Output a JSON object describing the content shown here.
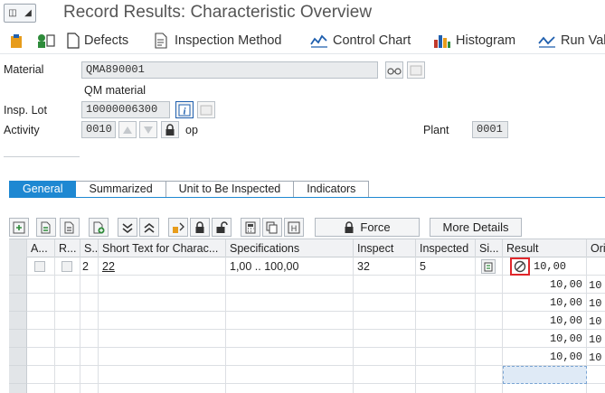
{
  "window": {
    "title": "Record Results: Characteristic Overview"
  },
  "toolbar": {
    "defects": "Defects",
    "inspection_method": "Inspection Method",
    "control_chart": "Control Chart",
    "histogram": "Histogram",
    "run_chart": "Run Val"
  },
  "form": {
    "material_label": "Material",
    "material_value": "QMA890001",
    "material_desc": "QM material",
    "insp_lot_label": "Insp. Lot",
    "insp_lot_value": "10000006300",
    "activity_label": "Activity",
    "activity_value": "0010",
    "activity_desc": "op",
    "plant_label": "Plant",
    "plant_value": "0001"
  },
  "tabs": [
    {
      "label": "General",
      "active": true
    },
    {
      "label": "Summarized"
    },
    {
      "label": "Unit to Be Inspected"
    },
    {
      "label": "Indicators"
    }
  ],
  "grid_toolbar": {
    "force": "Force",
    "more_details": "More Details"
  },
  "grid": {
    "columns": [
      "A...",
      "R...",
      "S...",
      "Short Text for Charac...",
      "Specifications",
      "Inspect",
      "Inspected",
      "Si...",
      "Result",
      "Ori"
    ],
    "main_row": {
      "seq": "2",
      "short_text": "22",
      "specifications": "1,00 .. 100,00",
      "inspect": "32",
      "inspected": "5",
      "result": "10,00"
    },
    "sub_rows": [
      {
        "result": "10,00",
        "ori": "10"
      },
      {
        "result": "10,00",
        "ori": "10"
      },
      {
        "result": "10,00",
        "ori": "10"
      },
      {
        "result": "10,00",
        "ori": "10"
      },
      {
        "result": "10,00",
        "ori": "10"
      }
    ]
  },
  "colors": {
    "accent": "#1e88d2",
    "highlight": "#e0262a"
  }
}
